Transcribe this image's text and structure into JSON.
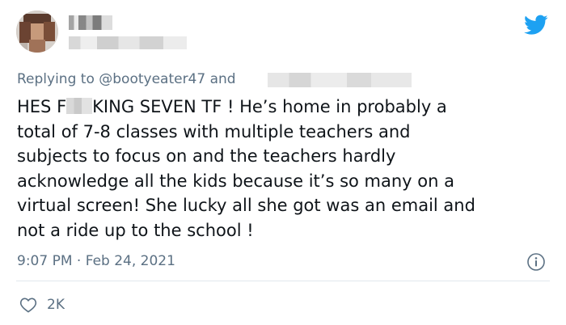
{
  "tweet": {
    "replying_prefix": "Replying to",
    "replying_mention": "@bootyeater47",
    "replying_conjunction": "and",
    "body_lines": [
      "HES F",
      "KING SEVEN TF ! He’s home in probably a",
      "total of 7-8 classes with multiple teachers and",
      "subjects to focus on and  the teachers hardly",
      "acknowledge all the kids because it’s so many on a",
      "virtual screen! She lucky all she got was an email and",
      "not a ride up to the school !"
    ],
    "time": "9:07 PM",
    "separator": "·",
    "date": "Feb 24, 2021",
    "like_count": "2K"
  },
  "icons": {
    "brand": "twitter-bird-icon",
    "info": "info-icon",
    "like": "heart-icon"
  },
  "colors": {
    "twitter_blue": "#1da1f2",
    "secondary_text": "#5b7083",
    "primary_text": "#0f1419",
    "divider": "#e1e8ed"
  }
}
